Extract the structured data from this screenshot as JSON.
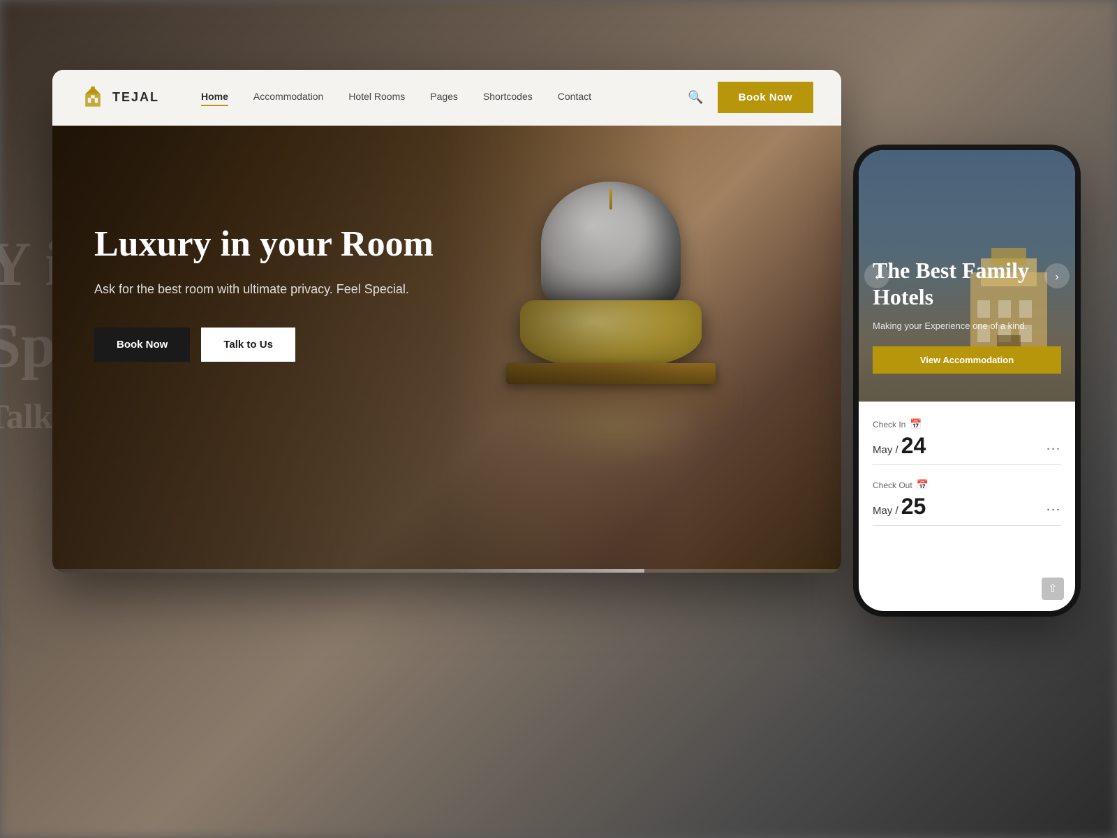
{
  "background": {
    "text_line1": "Y i",
    "text_line2": "Spe"
  },
  "navbar": {
    "logo_text": "TEJAL",
    "nav_links": [
      {
        "label": "Home",
        "active": true
      },
      {
        "label": "Accommodation",
        "active": false
      },
      {
        "label": "Hotel Rooms",
        "active": false
      },
      {
        "label": "Pages",
        "active": false
      },
      {
        "label": "Shortcodes",
        "active": false
      },
      {
        "label": "Contact",
        "active": false
      }
    ],
    "book_now": "Book Now"
  },
  "hero": {
    "title": "Luxury in your Room",
    "subtitle": "Ask for the best room with ultimate privacy. Feel Special.",
    "btn_book": "Book Now",
    "btn_talk": "Talk to Us"
  },
  "mobile": {
    "hero_title": "The Best Family Hotels",
    "hero_subtitle": "Making your Experience one of a kind.",
    "view_btn": "View Accommodation",
    "carousel_left": "‹",
    "carousel_right": "›",
    "checkin_label": "Check In",
    "checkin_month": "May /",
    "checkin_day": "24",
    "checkout_label": "Check Out",
    "checkout_month": "May /",
    "checkout_day": "25",
    "dots": "..."
  },
  "colors": {
    "gold": "#b8960c",
    "dark": "#1a1a1a",
    "white": "#ffffff"
  }
}
